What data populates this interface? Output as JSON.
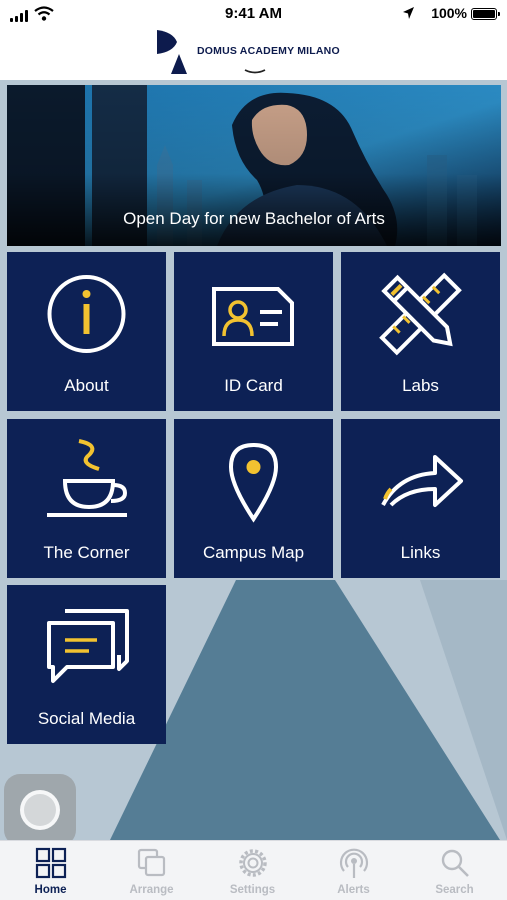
{
  "status_bar": {
    "time": "9:41 AM",
    "battery": "100%"
  },
  "header": {
    "brand": "DOMUS ACADEMY MILANO"
  },
  "banner": {
    "title": "Open Day for new Bachelor of Arts"
  },
  "tiles": [
    {
      "label": "About",
      "icon": "info-icon"
    },
    {
      "label": "ID Card",
      "icon": "id-card-icon"
    },
    {
      "label": "Labs",
      "icon": "ruler-pencil-icon"
    },
    {
      "label": "The Corner",
      "icon": "coffee-cup-icon"
    },
    {
      "label": "Campus Map",
      "icon": "map-pin-icon"
    },
    {
      "label": "Links",
      "icon": "share-arrow-icon"
    },
    {
      "label": "Social Media",
      "icon": "chat-bubbles-icon"
    }
  ],
  "tabbar": {
    "items": [
      {
        "label": "Home",
        "icon": "grid-icon",
        "active": true
      },
      {
        "label": "Arrange",
        "icon": "stack-icon",
        "active": false
      },
      {
        "label": "Settings",
        "icon": "gear-icon",
        "active": false
      },
      {
        "label": "Alerts",
        "icon": "broadcast-icon",
        "active": false
      },
      {
        "label": "Search",
        "icon": "search-icon",
        "active": false
      }
    ]
  },
  "colors": {
    "tile_bg": "#0d2155",
    "accent_yellow": "#f2c230",
    "background": "#b7c7d3",
    "shape": "#557d95",
    "active_tab": "#0d2155",
    "inactive_tab": "#b9bcc2"
  }
}
